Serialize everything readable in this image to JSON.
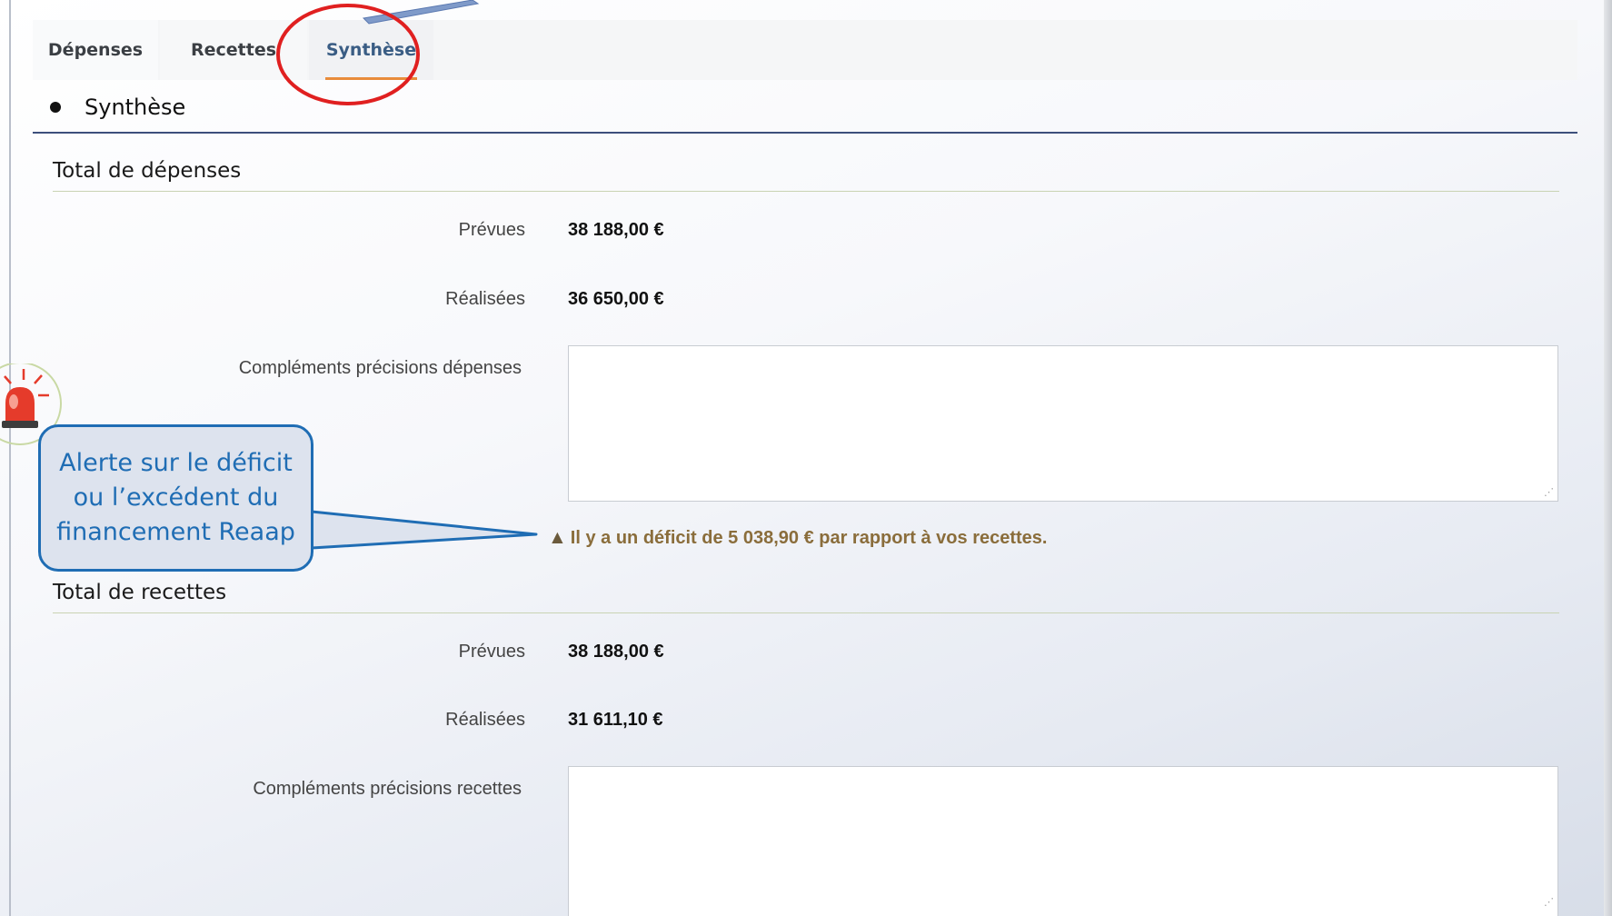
{
  "tabs": [
    {
      "label": "Dépenses"
    },
    {
      "label": "Recettes"
    },
    {
      "label": "Synthèse",
      "active": true
    }
  ],
  "section": {
    "title": "Synthèse"
  },
  "depenses": {
    "heading": "Total de dépenses",
    "prevues_label": "Prévues",
    "prevues_value": "38 188,00 €",
    "realisees_label": "Réalisées",
    "realisees_value": "36 650,00 €",
    "complements_label": "Compléments précisions dépenses",
    "complements_value": ""
  },
  "warning": {
    "icon": "warning-triangle-icon",
    "text": "Il y a un déficit de 5 038,90 € par rapport à vos recettes."
  },
  "callout": {
    "text": "Alerte sur le déficit ou l’excédent du financement Reaap"
  },
  "recettes": {
    "heading": "Total de recettes",
    "prevues_label": "Prévues",
    "prevues_value": "38 188,00 €",
    "realisees_label": "Réalisées",
    "realisees_value": "31 611,10 €",
    "complements_label": "Compléments précisions recettes",
    "complements_value": ""
  },
  "colors": {
    "active_tab_text": "#3a5d84",
    "active_tab_underline": "#e88c3a",
    "warning_text": "#8a6d3b",
    "callout_border": "#1f6db4",
    "annotation_circle": "#e02020"
  }
}
